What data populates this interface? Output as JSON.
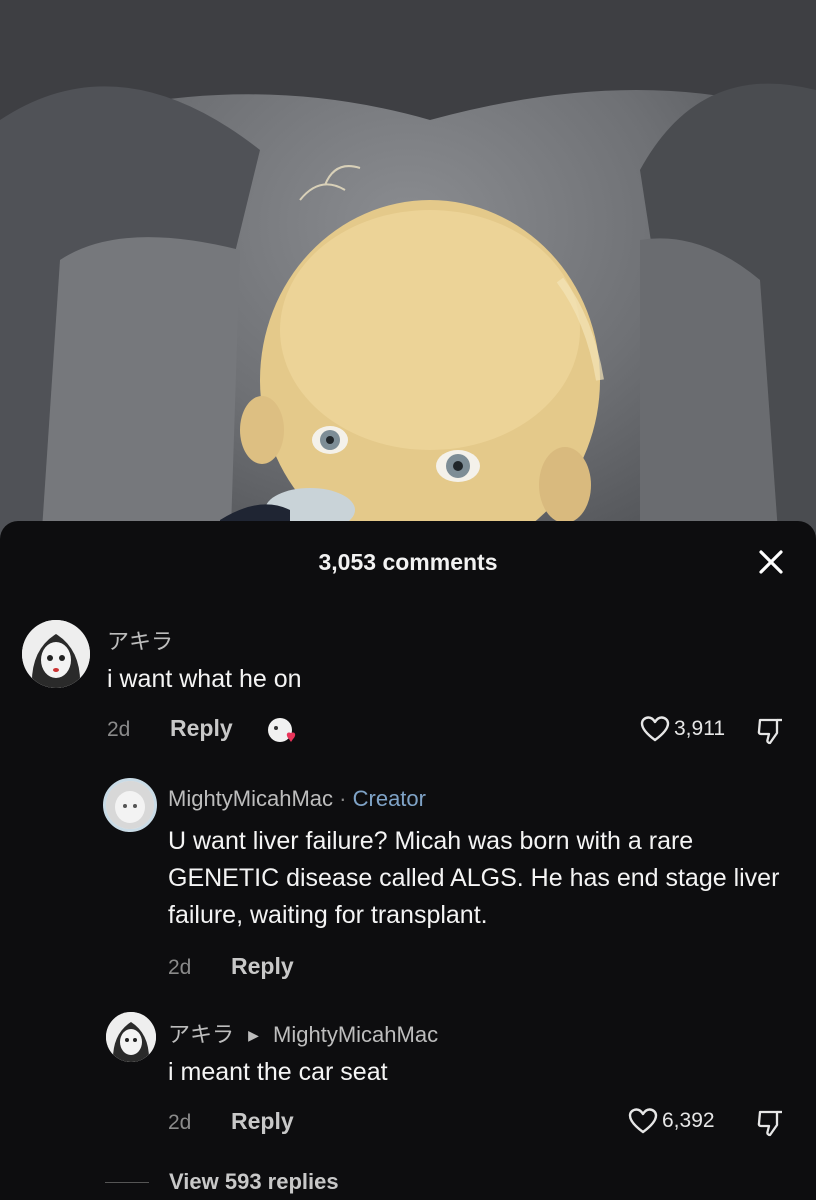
{
  "sheet": {
    "comment_count": "3,053 comments"
  },
  "comments": [
    {
      "username": "アキラ",
      "text": "i want what he on",
      "age": "2d",
      "reply_label": "Reply",
      "likes": "3,911"
    },
    {
      "username": "MightyMicahMac",
      "separator": "·",
      "badge": "Creator",
      "text": "U want liver failure? Micah was born with a rare GENETIC disease called ALGS. He has end stage liver failure, waiting for transplant.",
      "age": "2d",
      "reply_label": "Reply"
    },
    {
      "username": "アキラ",
      "reply_to": "MightyMicahMac",
      "text": "i meant the car seat",
      "age": "2d",
      "reply_label": "Reply",
      "likes": "6,392"
    }
  ],
  "view_replies": "View 593 replies",
  "icons": {
    "close": "close-icon",
    "heart": "heart-outline-icon",
    "dislike": "thumbs-down-icon",
    "sticker": "sticker-heart-icon",
    "reply_arrow": "caret-right-icon"
  },
  "colors": {
    "sheet_background": "#0d0d0f",
    "creator_badge": "#7fa3c7",
    "text_primary": "#f4f4f4",
    "text_muted": "#8a8a8a"
  }
}
